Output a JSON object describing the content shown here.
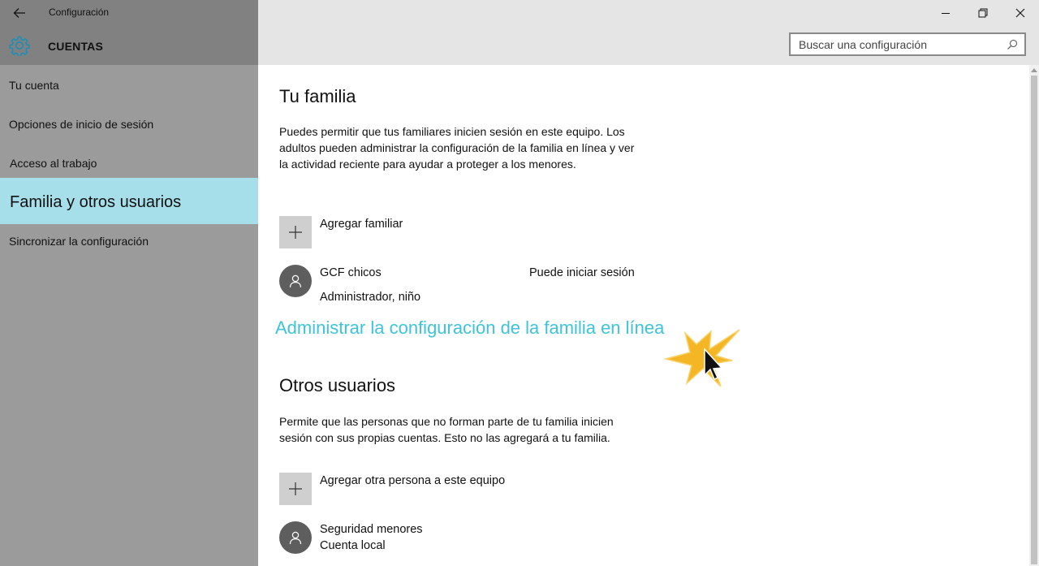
{
  "window": {
    "title": "Configuración",
    "minimize": "—",
    "restore": "❐",
    "close": "✕"
  },
  "sidebar": {
    "section_title": "CUENTAS",
    "items": [
      {
        "label": "Tu cuenta"
      },
      {
        "label": "Opciones de inicio de sesión"
      },
      {
        "label": "Acceso al trabajo"
      },
      {
        "label": "Familia y otros usuarios",
        "active": true
      },
      {
        "label": "Sincronizar la configuración"
      }
    ]
  },
  "search": {
    "placeholder": "Buscar una configuración"
  },
  "family": {
    "heading": "Tu familia",
    "description": "Puedes permitir que tus familiares inicien sesión en este equipo. Los adultos pueden administrar la configuración de la familia en línea y ver la actividad reciente para ayudar a proteger a los menores.",
    "add_label": "Agregar familiar",
    "member": {
      "name": "GCF chicos",
      "role": "Administrador, niño",
      "status": "Puede iniciar sesión"
    },
    "manage_link": "Administrar la configuración de la familia en línea"
  },
  "others": {
    "heading": "Otros usuarios",
    "description": "Permite que las personas que no forman parte de tu familia inicien sesión con sus propias cuentas. Esto no las agregará a tu familia.",
    "add_label": "Agregar otra persona a este equipo",
    "user": {
      "name": "Seguridad menores",
      "type": "Cuenta local"
    }
  },
  "colors": {
    "sidebar_bg": "#9b9b9b",
    "sidebar_header": "#818181",
    "active_item": "#a6dfe9",
    "link": "#3ec4d8",
    "accent": "#1b8fb5"
  },
  "icons": [
    "back-arrow-icon",
    "gear-icon",
    "search-icon",
    "plus-icon",
    "person-icon",
    "mouse-cursor-icon"
  ]
}
